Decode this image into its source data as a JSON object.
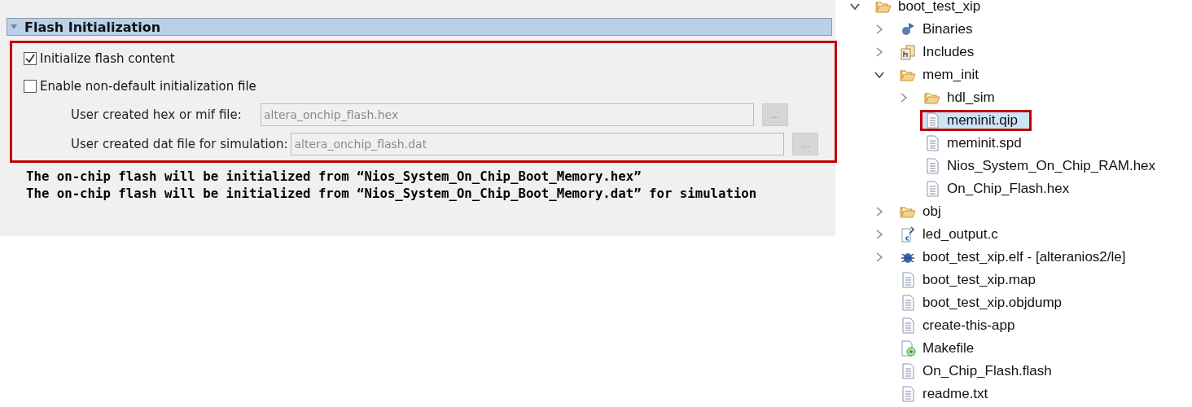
{
  "section": {
    "title": "Flash Initialization",
    "expanded": true,
    "options": [
      {
        "label": "Initialize flash content",
        "checked": true
      },
      {
        "label": "Enable non-default initialization file",
        "checked": false
      }
    ],
    "fields": [
      {
        "label": "User created hex or mif file:",
        "value": "altera_onchip_flash.hex",
        "browse": "...",
        "disabled": true
      },
      {
        "label": "User created dat file for simulation:",
        "value": "altera_onchip_flash.dat",
        "browse": "...",
        "disabled": true
      }
    ],
    "callout": true,
    "messages": [
      "The on-chip flash will be initialized from “Nios_System_On_Chip_Boot_Memory.hex”",
      "The on-chip flash will be initialized from “Nios_System_On_Chip_Boot_Memory.dat” for simulation"
    ]
  },
  "tree": {
    "items": [
      {
        "label": "boot_test_xip",
        "kind": "project",
        "expanded": true,
        "selected": false,
        "children": [
          {
            "label": "Binaries",
            "kind": "binaries",
            "expanded": false,
            "selected": false
          },
          {
            "label": "Includes",
            "kind": "includes",
            "expanded": false,
            "selected": false
          },
          {
            "label": "mem_init",
            "kind": "folder",
            "expanded": true,
            "selected": false,
            "children": [
              {
                "label": "hdl_sim",
                "kind": "folder",
                "expanded": false,
                "selected": false
              },
              {
                "label": "meminit.qip",
                "kind": "file",
                "selected": true,
                "callout": true
              },
              {
                "label": "meminit.spd",
                "kind": "file",
                "selected": false
              },
              {
                "label": "Nios_System_On_Chip_RAM.hex",
                "kind": "file",
                "selected": false
              },
              {
                "label": "On_Chip_Flash.hex",
                "kind": "file",
                "selected": false
              }
            ]
          },
          {
            "label": "obj",
            "kind": "folder",
            "expanded": false,
            "selected": false
          },
          {
            "label": "led_output.c",
            "kind": "csource",
            "expanded": false,
            "selected": false
          },
          {
            "label": "boot_test_xip.elf - [alteranios2/le]",
            "kind": "binary",
            "expanded": false,
            "selected": false
          },
          {
            "label": "boot_test_xip.map",
            "kind": "file",
            "selected": false
          },
          {
            "label": "boot_test_xip.objdump",
            "kind": "file",
            "selected": false
          },
          {
            "label": "create-this-app",
            "kind": "file",
            "selected": false
          },
          {
            "label": "Makefile",
            "kind": "makefile",
            "selected": false
          },
          {
            "label": "On_Chip_Flash.flash",
            "kind": "file",
            "selected": false
          },
          {
            "label": "readme.txt",
            "kind": "file",
            "selected": false
          }
        ]
      }
    ]
  }
}
